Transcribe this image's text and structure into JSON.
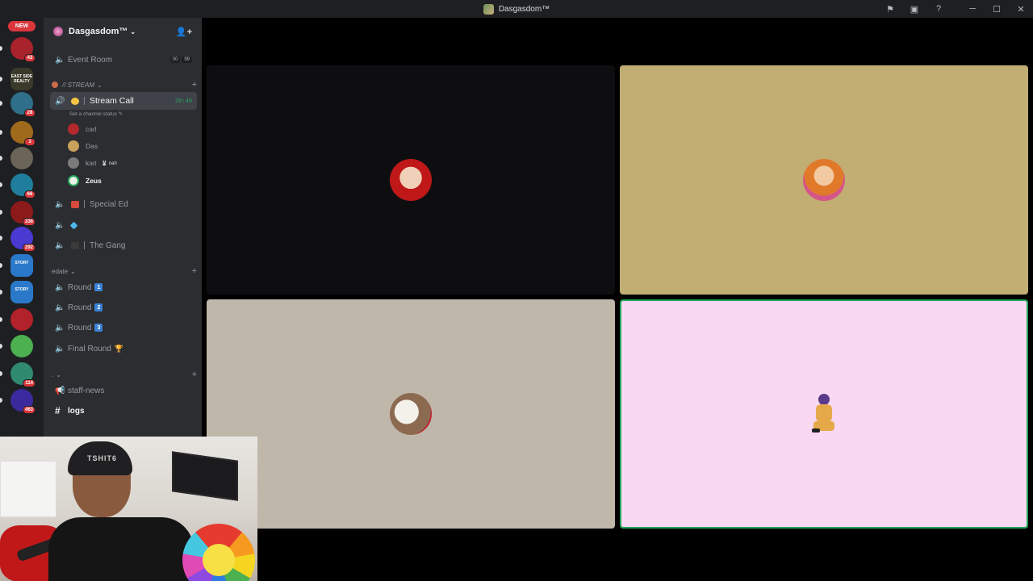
{
  "window": {
    "title": "Dasgasdom™",
    "icons": [
      "flag-icon",
      "inbox-icon",
      "help-icon",
      "minimize-icon",
      "maximize-icon",
      "close-icon"
    ]
  },
  "rail": {
    "new_label": "NEW",
    "servers": [
      {
        "badge": "43",
        "color": "#a8232c"
      },
      {
        "badge": "",
        "color": "#3a3a2a",
        "label": "EAST SIDE REALTY"
      },
      {
        "badge": "28",
        "color": "#2f6f8a"
      },
      {
        "badge": "3",
        "color": "#a06a1c"
      },
      {
        "badge": "",
        "color": "#6b6458"
      },
      {
        "badge": "66",
        "color": "#1f7e9c"
      },
      {
        "badge": "336",
        "color": "#8c1a1a"
      },
      {
        "badge": "292",
        "color": "#4a3ad1"
      },
      {
        "badge": "",
        "color": "#2a78c9",
        "label": "STORY"
      },
      {
        "badge": "",
        "color": "#2a78c9",
        "label": "STORY"
      },
      {
        "badge": "",
        "color": "#b2222a"
      },
      {
        "badge": "",
        "color": "#4caf50"
      },
      {
        "badge": "114",
        "color": "#2f8a6f"
      },
      {
        "badge": "463",
        "color": "#3b2a9e"
      }
    ]
  },
  "sidebar": {
    "guild_name": "Dasgasdom™",
    "channels_top": [
      {
        "name": "Event Room",
        "limits": [
          "00",
          "99"
        ]
      }
    ],
    "stream_category": "// STREAM",
    "stream_call": {
      "name": "Stream Call",
      "time": "20:49",
      "status": "Set a channel status"
    },
    "voice_users": [
      {
        "name": "carl",
        "color": "#b3272d"
      },
      {
        "name": "Das",
        "color": "#c9a15a"
      },
      {
        "name": "kari",
        "color": "#7a7a7a",
        "extra": "🐰 nah"
      },
      {
        "name": "Zeus",
        "color": "#e9f2e6"
      }
    ],
    "channels_mid": [
      {
        "name": "Special Ed",
        "emoji_color": "#d94a3a"
      },
      {
        "name": "",
        "emoji_color": "#4db8e8"
      },
      {
        "name": "The Gang",
        "emoji_color": "#3a3a3a"
      }
    ],
    "edate_category": "edate",
    "rounds": [
      {
        "name": "Round",
        "num": "1"
      },
      {
        "name": "Round",
        "num": "2"
      },
      {
        "name": "Round",
        "num": "3"
      },
      {
        "name": "Final Round",
        "trophy": "🏆"
      }
    ],
    "dot_category": ". ",
    "text_channels": [
      {
        "name": "staff-news",
        "icon": "megaphone-icon"
      },
      {
        "name": "logs",
        "icon": "hash-icon"
      }
    ]
  },
  "webcam": {
    "beanie_text": "TSHIT6"
  },
  "tiles": [
    {
      "name": "tile-1",
      "bg": "#0e0e11",
      "speaking": false
    },
    {
      "name": "tile-2",
      "bg": "#c2ad72",
      "speaking": false
    },
    {
      "name": "tile-3",
      "bg": "#c0b7ab",
      "speaking": false
    },
    {
      "name": "tile-4",
      "bg": "#f9d8f2",
      "speaking": true
    }
  ]
}
